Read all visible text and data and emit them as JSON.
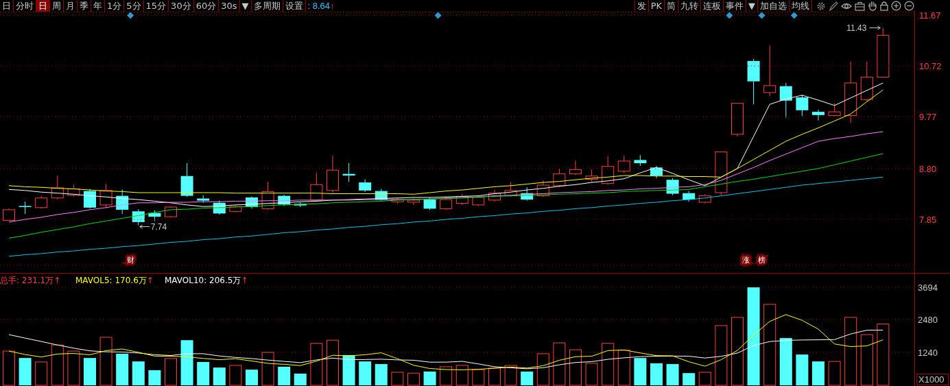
{
  "toolbar": {
    "left": [
      {
        "label": "日",
        "selected": false
      },
      {
        "label": "分时",
        "selected": false
      },
      {
        "label": "日",
        "selected": true
      },
      {
        "label": "周",
        "selected": false
      },
      {
        "label": "月",
        "selected": false
      },
      {
        "label": "季",
        "selected": false
      },
      {
        "label": "年",
        "selected": false
      },
      {
        "label": "1分",
        "selected": false
      },
      {
        "label": "5分",
        "selected": false
      },
      {
        "label": "15分",
        "selected": false
      },
      {
        "label": "30分",
        "selected": false
      },
      {
        "label": "60分",
        "selected": false
      },
      {
        "label": "30s",
        "selected": false
      },
      {
        "label": "▼",
        "selected": false
      },
      {
        "label": "多周期",
        "selected": false
      },
      {
        "label": "设置",
        "selected": false
      }
    ],
    "reading": {
      "value": ": 8.64",
      "arrow": "↑"
    },
    "right": [
      {
        "label": "发"
      },
      {
        "label": "PK"
      },
      {
        "label": "简"
      },
      {
        "label": "九转"
      },
      {
        "label": "连板"
      },
      {
        "label": "事件"
      },
      {
        "label": "▼"
      },
      {
        "label": "加自选"
      },
      {
        "label": "均线"
      }
    ]
  },
  "price_chart": {
    "high_label": "11.43",
    "low_label": "7.74",
    "tags": [
      "财",
      "涨",
      "榜"
    ],
    "chart_data": {
      "type": "line",
      "ylim": [
        6.85,
        11.72
      ],
      "yticks": [
        7.85,
        {
          "value": 8.8,
          "label": "8.80"
        },
        9.77,
        10.72,
        11.67
      ],
      "grid": true,
      "series": [
        {
          "color": "#ffffff",
          "values": [
            8.41,
            8.39,
            8.36,
            8.34,
            8.32,
            8.29,
            8.27,
            8.24,
            8.22,
            8.19,
            8.16,
            8.12,
            8.09,
            8.1,
            8.12,
            8.13,
            8.15,
            8.16,
            8.18,
            8.19,
            8.21,
            8.22,
            8.23,
            8.24,
            8.25,
            8.26,
            8.26,
            8.27,
            8.28,
            8.29,
            8.33,
            8.36,
            8.4,
            8.43,
            8.47,
            8.5,
            8.54,
            8.57,
            8.61,
            8.72,
            8.82,
            8.71,
            8.59,
            8.48,
            8.64,
            8.8,
            9.4,
            10.0,
            10.1,
            10.17,
            10.08,
            9.98,
            10.12,
            10.26,
            10.4
          ]
        },
        {
          "color": "#ffff00",
          "values": [
            8.48,
            8.46,
            8.45,
            8.43,
            8.42,
            8.4,
            8.38,
            8.37,
            8.35,
            8.35,
            8.35,
            8.35,
            8.35,
            8.35,
            8.34,
            8.34,
            8.34,
            8.34,
            8.34,
            8.34,
            8.33,
            8.33,
            8.33,
            8.33,
            8.33,
            8.32,
            8.35,
            8.38,
            8.4,
            8.43,
            8.46,
            8.48,
            8.51,
            8.54,
            8.56,
            8.59,
            8.62,
            8.64,
            8.67,
            8.67,
            8.66,
            8.66,
            8.65,
            8.65,
            8.64,
            8.8,
            8.97,
            9.14,
            9.31,
            9.44,
            9.56,
            9.69,
            9.82,
            10.05,
            10.27
          ]
        },
        {
          "color": "#ff80ff",
          "values": [
            7.8,
            7.85,
            7.89,
            7.94,
            7.98,
            8.03,
            8.07,
            8.12,
            8.16,
            8.16,
            8.17,
            8.17,
            8.18,
            8.18,
            8.19,
            8.19,
            8.2,
            8.2,
            8.21,
            8.21,
            8.21,
            8.21,
            8.22,
            8.22,
            8.22,
            8.22,
            8.23,
            8.25,
            8.26,
            8.27,
            8.29,
            8.3,
            8.32,
            8.33,
            8.35,
            8.36,
            8.37,
            8.39,
            8.4,
            8.42,
            8.43,
            8.45,
            8.46,
            8.5,
            8.58,
            8.7,
            8.82,
            8.95,
            9.07,
            9.19,
            9.31,
            9.36,
            9.4,
            9.45,
            9.49
          ]
        },
        {
          "color": "#00e000",
          "values": [
            7.5,
            7.55,
            7.61,
            7.66,
            7.71,
            7.77,
            7.82,
            7.87,
            7.92,
            7.98,
            8.03,
            8.04,
            8.06,
            8.07,
            8.08,
            8.09,
            8.11,
            8.12,
            8.13,
            8.14,
            8.16,
            8.17,
            8.18,
            8.19,
            8.21,
            8.22,
            8.23,
            8.24,
            8.25,
            8.27,
            8.28,
            8.29,
            8.3,
            8.31,
            8.32,
            8.33,
            8.34,
            8.35,
            8.37,
            8.38,
            8.39,
            8.4,
            8.41,
            8.46,
            8.51,
            8.56,
            8.6,
            8.65,
            8.7,
            8.75,
            8.8,
            8.87,
            8.94,
            9.01,
            9.08
          ]
        },
        {
          "color": "#00c8e8",
          "values": [
            7.16,
            7.19,
            7.21,
            7.24,
            7.26,
            7.29,
            7.31,
            7.34,
            7.36,
            7.39,
            7.42,
            7.44,
            7.47,
            7.49,
            7.52,
            7.54,
            7.57,
            7.6,
            7.62,
            7.65,
            7.67,
            7.7,
            7.72,
            7.75,
            7.77,
            7.8,
            7.82,
            7.85,
            7.87,
            7.9,
            7.92,
            7.95,
            7.97,
            8.0,
            8.02,
            8.05,
            8.07,
            8.1,
            8.12,
            8.15,
            8.17,
            8.2,
            8.22,
            8.25,
            8.29,
            8.33,
            8.37,
            8.41,
            8.45,
            8.49,
            8.52,
            8.55,
            8.58,
            8.61,
            8.64
          ]
        }
      ]
    }
  },
  "volume_chart": {
    "legend": [
      {
        "text": "总手: 231.1万",
        "arrow": "↑",
        "color": "#ff3c3c"
      },
      {
        "text": "MAVOL5: 170.6万",
        "arrow": "↑",
        "color": "#ffff00"
      },
      {
        "text": "MAVOL10: 206.5万",
        "arrow": "↑",
        "color": "#ffffff"
      }
    ],
    "chart_data": {
      "type": "bar",
      "ylim": [
        0,
        3694
      ],
      "yticks": [
        1240,
        2480,
        3694
      ],
      "grid": true,
      "values": [
        1290,
        1030,
        880,
        1520,
        1290,
        1030,
        1810,
        1190,
        900,
        570,
        1010,
        1700,
        880,
        670,
        750,
        590,
        1240,
        700,
        440,
        1580,
        1700,
        1140,
        900,
        800,
        490,
        460,
        520,
        700,
        750,
        590,
        650,
        750,
        520,
        1190,
        1600,
        1340,
        830,
        1580,
        1320,
        1030,
        830,
        800,
        460,
        490,
        2250,
        2560,
        3690,
        3050,
        1780,
        1160,
        900,
        900,
        2560,
        1910,
        2311
      ]
    },
    "average_chart": {
      "chart_data": {
        "type": "line",
        "ylim": [
          0,
          3694
        ],
        "series": [
          {
            "color": "#ffffff",
            "values": [
              1910,
              1780,
              1650,
              1520,
              1400,
              1300,
              1264,
              1255,
              1216,
              1151,
              1123,
              1190,
              1190,
              1105,
              1051,
              1007,
              950,
              901,
              855,
              956,
              1025,
              969,
              971,
              984,
              958,
              945,
              873,
              873,
              904,
              805,
              700,
              661,
              623,
              662,
              773,
              861,
              892,
              980,
              1037,
              1081,
              1099,
              1104,
              1098,
              1028,
              1093,
              1215,
              1501,
              1648,
              1694,
              1707,
              1714,
              1724,
              1934,
              2076,
              2082
            ]
          },
          {
            "color": "#ffff00",
            "values": [
              1290,
              1160,
              1067,
              1180,
              1202,
              1150,
              1306,
              1368,
              1244,
              1100,
              1096,
              1074,
              1012,
              966,
              1002,
              918,
              826,
              790,
              744,
              910,
              1132,
              1112,
              1152,
              1224,
              1006,
              758,
              634,
              594,
              584,
              604,
              642,
              688,
              652,
              740,
              942,
              1080,
              1096,
              1308,
              1334,
              1220,
              1118,
              1112,
              888,
              722,
              966,
              1312,
              1890,
              2408,
              2666,
              2448,
              2116,
              1558,
              1460,
              1486,
              1716
            ]
          }
        ]
      }
    },
    "unit": "X1000"
  }
}
